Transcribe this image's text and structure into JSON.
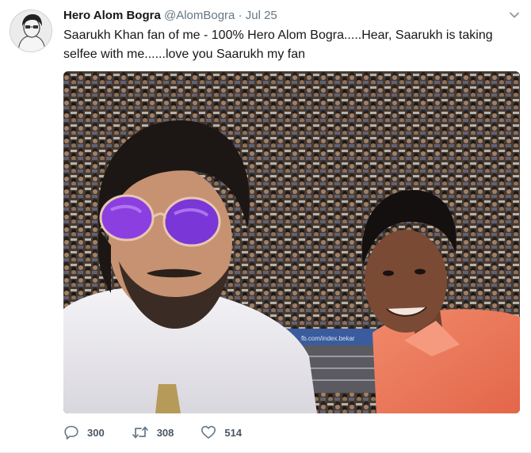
{
  "tweet": {
    "fullname": "Hero Alom Bogra",
    "username": "@AlomBogra",
    "separator": "·",
    "timestamp": "Jul 25",
    "text": "Saarukh Khan fan of me - 100% Hero Alom Bogra.....Hear, Saarukh is taking selfee with me......love you Saarukh my fan",
    "media_watermark": "fb.com/index.bekar"
  },
  "actions": {
    "reply_count": "300",
    "retweet_count": "308",
    "like_count": "514"
  },
  "colors": {
    "text_primary": "#14171a",
    "text_secondary": "#657786",
    "divider": "#e6ecf0"
  },
  "icons": {
    "reply": "reply-icon",
    "retweet": "retweet-icon",
    "like": "heart-icon",
    "menu": "chevron-down-icon"
  }
}
